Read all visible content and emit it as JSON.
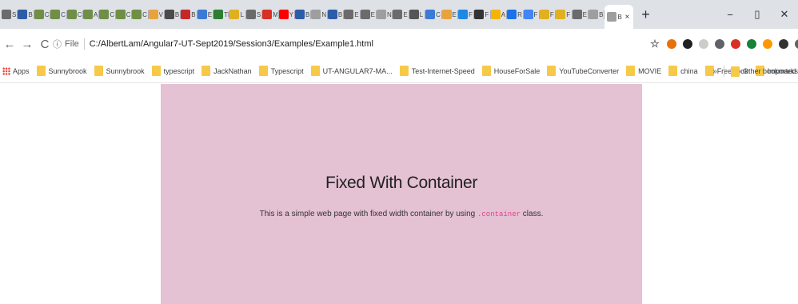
{
  "tabs": [
    {
      "icon": "tab-favicon-icon",
      "label": "S",
      "color": "#6b6b6b"
    },
    {
      "icon": "tab-favicon-icon",
      "label": "B",
      "color": "#2d5da8"
    },
    {
      "icon": "tab-favicon-icon",
      "label": "C",
      "color": "#6f8f45"
    },
    {
      "icon": "tab-favicon-icon",
      "label": "C",
      "color": "#6f8f45"
    },
    {
      "icon": "tab-favicon-icon",
      "label": "C",
      "color": "#6f8f45"
    },
    {
      "icon": "tab-favicon-icon",
      "label": "A",
      "color": "#6f8f45"
    },
    {
      "icon": "tab-favicon-icon",
      "label": "C",
      "color": "#6f8f45"
    },
    {
      "icon": "tab-favicon-icon",
      "label": "C",
      "color": "#6f8f45"
    },
    {
      "icon": "tab-favicon-icon",
      "label": "C",
      "color": "#6f8f45"
    },
    {
      "icon": "tab-favicon-icon",
      "label": "V",
      "color": "#e8a33d"
    },
    {
      "icon": "tab-favicon-icon",
      "label": "B",
      "color": "#4a4a4a"
    },
    {
      "icon": "tab-favicon-icon",
      "label": "B",
      "color": "#c62828"
    },
    {
      "icon": "tab-favicon-icon",
      "label": "E",
      "color": "#3a7bd5"
    },
    {
      "icon": "tab-favicon-icon",
      "label": "TD",
      "color": "#2e7d32"
    },
    {
      "icon": "tab-favicon-icon",
      "label": "L",
      "color": "#e0b020"
    },
    {
      "icon": "tab-favicon-icon",
      "label": "S",
      "color": "#6b6b6b"
    },
    {
      "icon": "tab-favicon-icon",
      "label": "M",
      "color": "#d93025"
    },
    {
      "icon": "tab-favicon-icon",
      "label": "Y",
      "color": "#ff0000"
    },
    {
      "icon": "tab-favicon-icon",
      "label": "B",
      "color": "#2d5da8"
    },
    {
      "icon": "tab-favicon-icon",
      "label": "New",
      "color": "#9e9e9e"
    },
    {
      "icon": "tab-favicon-icon",
      "label": "B",
      "color": "#2d5da8"
    },
    {
      "icon": "tab-favicon-icon",
      "label": "E",
      "color": "#6b6b6b"
    },
    {
      "icon": "tab-favicon-icon",
      "label": "E",
      "color": "#6b6b6b"
    },
    {
      "icon": "tab-favicon-icon",
      "label": "New",
      "color": "#9e9e9e"
    },
    {
      "icon": "tab-favicon-icon",
      "label": "E",
      "color": "#6b6b6b"
    },
    {
      "icon": "tab-favicon-icon",
      "label": "L",
      "color": "#555555"
    },
    {
      "icon": "tab-favicon-icon",
      "label": "C",
      "color": "#3a7bd5"
    },
    {
      "icon": "tab-favicon-icon",
      "label": "E",
      "color": "#e8a33d"
    },
    {
      "icon": "tab-favicon-icon",
      "label": "F",
      "color": "#1e88e5"
    },
    {
      "icon": "tab-favicon-icon",
      "label": "F",
      "color": "#333333"
    },
    {
      "icon": "tab-favicon-icon",
      "label": "A",
      "color": "#f4b400"
    },
    {
      "icon": "tab-favicon-icon",
      "label": "R",
      "color": "#1a73e8"
    },
    {
      "icon": "tab-favicon-icon",
      "label": "F",
      "color": "#4285f4"
    },
    {
      "icon": "tab-favicon-icon",
      "label": "F",
      "color": "#e0b020"
    },
    {
      "icon": "tab-favicon-icon",
      "label": "F",
      "color": "#e0b020"
    },
    {
      "icon": "tab-favicon-icon",
      "label": "E",
      "color": "#6b6b6b"
    },
    {
      "icon": "tab-favicon-icon",
      "label": "B",
      "color": "#9e9e9e"
    }
  ],
  "active_tab": {
    "label": "B",
    "close": "×"
  },
  "new_tab_label": "+",
  "window_controls": {
    "minimize": "−",
    "maximize": "▯",
    "close": "✕"
  },
  "nav": {
    "back": "←",
    "forward": "→",
    "reload": "C"
  },
  "address": {
    "scheme": "File",
    "url": "C:/AlbertLam/Angular7-UT-Sept2019/Session3/Examples/Example1.html"
  },
  "extensions": [
    {
      "name": "bookmark-star-icon",
      "glyph": "☆",
      "color": "#5f6368"
    },
    {
      "name": "extension-icon",
      "glyph": "",
      "color": "#e8710a"
    },
    {
      "name": "extension-icon",
      "glyph": "",
      "color": "#202124"
    },
    {
      "name": "extension-icon",
      "glyph": "",
      "color": "#cccccc"
    },
    {
      "name": "extension-icon",
      "glyph": "",
      "color": "#5f6368"
    },
    {
      "name": "extension-icon",
      "glyph": "",
      "color": "#d93025"
    },
    {
      "name": "extension-icon",
      "glyph": "",
      "color": "#188038"
    },
    {
      "name": "extension-icon",
      "glyph": "",
      "color": "#ff9800"
    },
    {
      "name": "extension-icon",
      "glyph": "",
      "color": "#333333"
    },
    {
      "name": "extension-icon",
      "glyph": "",
      "color": "#5f6368"
    },
    {
      "name": "profile-icon",
      "glyph": "A",
      "color": "#f57c00"
    },
    {
      "name": "menu-icon",
      "glyph": "⋮",
      "color": "#5f6368"
    }
  ],
  "bookmarks": {
    "apps_label": "Apps",
    "items": [
      "Sunnybrook",
      "Sunnybrook",
      "typescript",
      "JackNathan",
      "Typescript",
      "UT-ANGULAR7-MA...",
      "Test-Internet-Speed",
      "HouseForSale",
      "YouTubeConverter",
      "MOVIE",
      "china",
      "FreeBook",
      "Imported",
      "Jenkins",
      "Timesheet",
      "GoogleDrive"
    ],
    "overflow": "»",
    "other": "Other bookmarks"
  },
  "page": {
    "heading": "Fixed With Container",
    "text_before": "This is a simple web page with fixed width container by using ",
    "code": ".container",
    "text_after": " class."
  },
  "colors": {
    "container_bg": "#e4c1d3",
    "code": "#e83e8c",
    "tabstrip": "#dee1e6"
  }
}
